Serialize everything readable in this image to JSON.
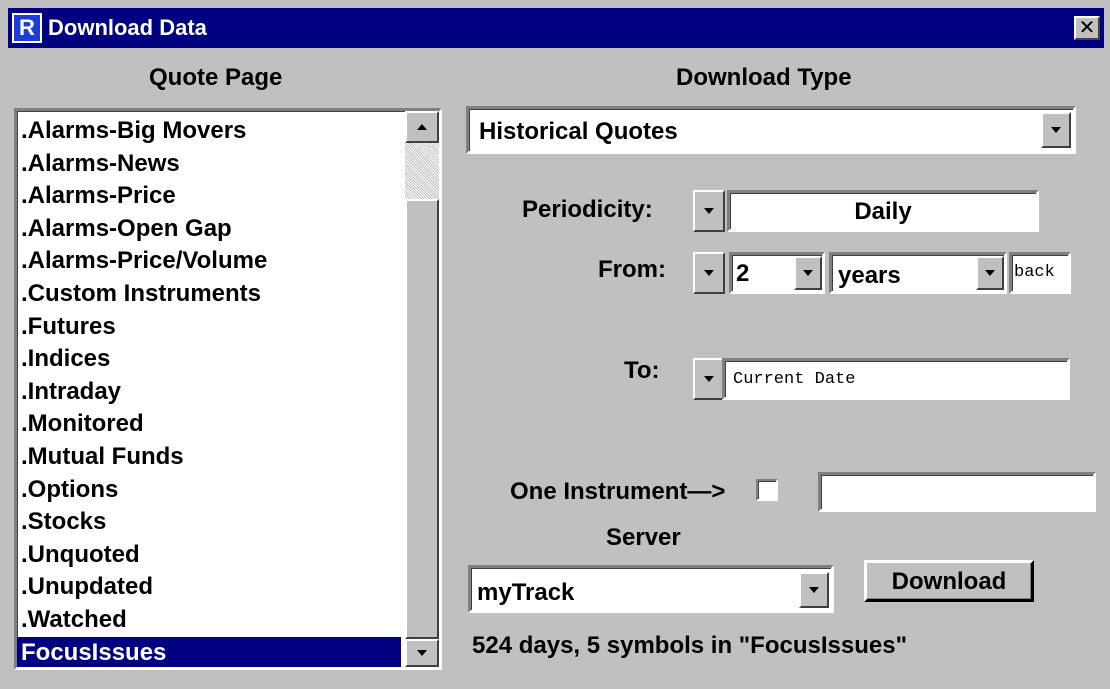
{
  "window": {
    "title": "Download Data",
    "close_glyph": "✕",
    "icon": "R"
  },
  "quote_page": {
    "label": "Quote Page",
    "items": [
      ".Alarms-Big Movers",
      ".Alarms-News",
      ".Alarms-Price",
      ".Alarms-Open Gap",
      ".Alarms-Price/Volume",
      ".Custom Instruments",
      ".Futures",
      ".Indices",
      ".Intraday",
      ".Monitored",
      ".Mutual Funds",
      ".Options",
      ".Stocks",
      ".Unquoted",
      ".Unupdated",
      ".Watched",
      "FocusIssues"
    ],
    "selected": "FocusIssues"
  },
  "download_type": {
    "label": "Download Type",
    "value": "Historical Quotes"
  },
  "periodicity": {
    "label": "Periodicity:",
    "value": "Daily"
  },
  "from": {
    "label": "From:",
    "count": "2",
    "unit": "years",
    "suffix": "back"
  },
  "to": {
    "label": "To:",
    "value": "Current Date"
  },
  "one_instrument": {
    "label": "One Instrument—>",
    "checked": false,
    "value": ""
  },
  "server": {
    "label": "Server",
    "value": "myTrack"
  },
  "download_button": {
    "label": "Download"
  },
  "status": {
    "text": "524 days, 5 symbols in \"FocusIssues\""
  },
  "colors": {
    "titlebar": "#000080",
    "face": "#c0c0c0",
    "selection": "#000080"
  }
}
